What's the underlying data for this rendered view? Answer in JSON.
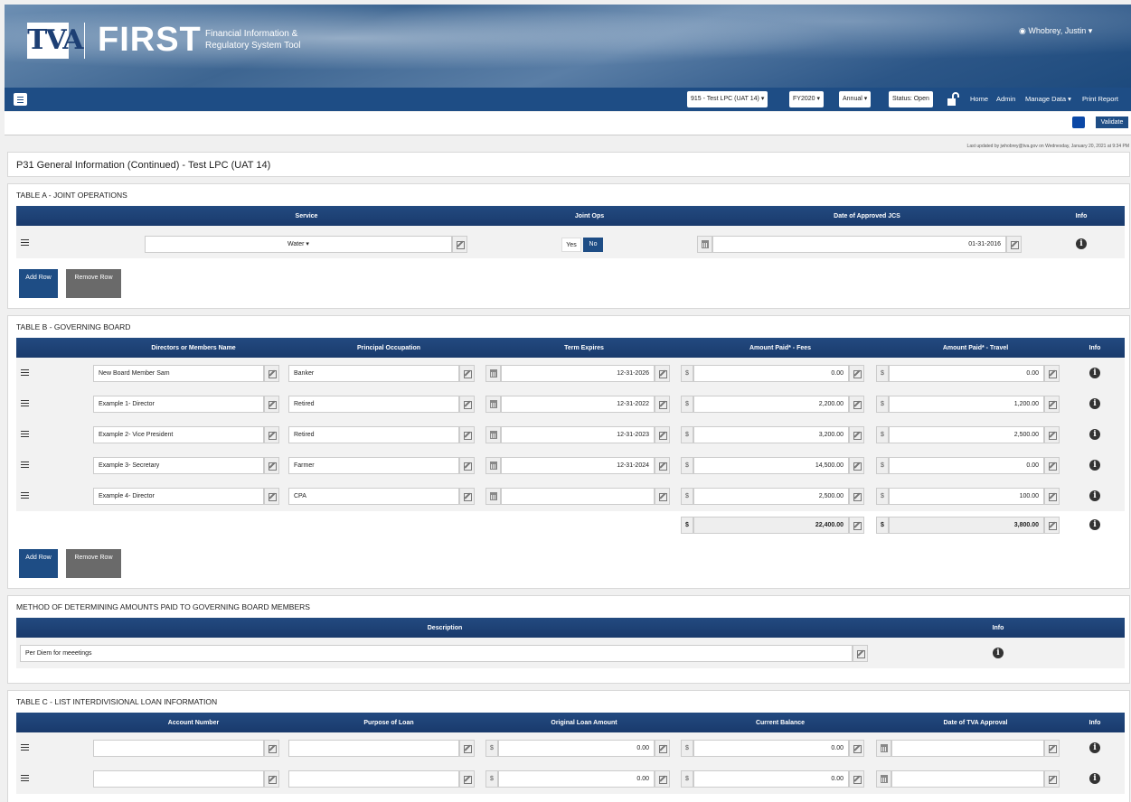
{
  "header": {
    "logo": "TVA",
    "app_name": "FIRST",
    "app_subtitle": "Financial Information & Regulatory System Tool",
    "user": "Whobrey, Justin"
  },
  "navbar": {
    "entity": "915 - Test LPC (UAT 14)",
    "fiscal_year": "FY2020",
    "period": "Annual",
    "status": "Status: Open",
    "links": [
      "Home",
      "Admin",
      "Manage Data",
      "Print Report"
    ]
  },
  "toolbar": {
    "validate": "Validate"
  },
  "last_updated": "Last updated by jwhobrey@tva.gov on Wednesday, January 20, 2021 at 9:34 PM",
  "page_title": "P31 General Information (Continued) - Test LPC (UAT 14)",
  "table_a": {
    "title": "TABLE A - JOINT OPERATIONS",
    "headers": [
      "Service",
      "Joint Ops",
      "Date of Approved JCS",
      "Info"
    ],
    "rows": [
      {
        "service": "Water",
        "joint_yes": "Yes",
        "joint_no": "No",
        "joint_selected": "No",
        "date": "01-31-2016"
      }
    ],
    "add": "Add Row",
    "remove": "Remove Row"
  },
  "table_b": {
    "title": "TABLE B - GOVERNING BOARD",
    "headers": [
      "Directors or Members Name",
      "Principal Occupation",
      "Term Expires",
      "Amount Paid* - Fees",
      "Amount Paid* - Travel",
      "Info"
    ],
    "rows": [
      {
        "name": "New Board Member Sam",
        "occupation": "Banker",
        "term": "12-31-2026",
        "fees": "0.00",
        "travel": "0.00"
      },
      {
        "name": "Example 1- Director",
        "occupation": "Retired",
        "term": "12-31-2022",
        "fees": "2,200.00",
        "travel": "1,200.00"
      },
      {
        "name": "Example 2- Vice President",
        "occupation": "Retired",
        "term": "12-31-2023",
        "fees": "3,200.00",
        "travel": "2,500.00"
      },
      {
        "name": "Example 3- Secretary",
        "occupation": "Farmer",
        "term": "12-31-2024",
        "fees": "14,500.00",
        "travel": "0.00"
      },
      {
        "name": "Example 4- Director",
        "occupation": "CPA",
        "term": "",
        "fees": "2,500.00",
        "travel": "100.00"
      }
    ],
    "totals": {
      "currency": "$",
      "fees": "22,400.00",
      "travel": "3,800.00"
    },
    "currency": "$",
    "add": "Add Row",
    "remove": "Remove Row"
  },
  "method": {
    "title": "METHOD OF DETERMINING AMOUNTS PAID TO GOVERNING BOARD MEMBERS",
    "headers": [
      "Description",
      "Info"
    ],
    "description": "Per Diem for meeetings"
  },
  "table_c": {
    "title": "TABLE C - LIST INTERDIVISIONAL LOAN INFORMATION",
    "headers": [
      "Account Number",
      "Purpose of Loan",
      "Original Loan Amount",
      "Current Balance",
      "Date of TVA Approval",
      "Info"
    ],
    "rows": [
      {
        "account": "",
        "purpose": "",
        "original": "0.00",
        "balance": "0.00",
        "date": ""
      },
      {
        "account": "",
        "purpose": "",
        "original": "0.00",
        "balance": "0.00",
        "date": ""
      }
    ],
    "currency": "$"
  }
}
